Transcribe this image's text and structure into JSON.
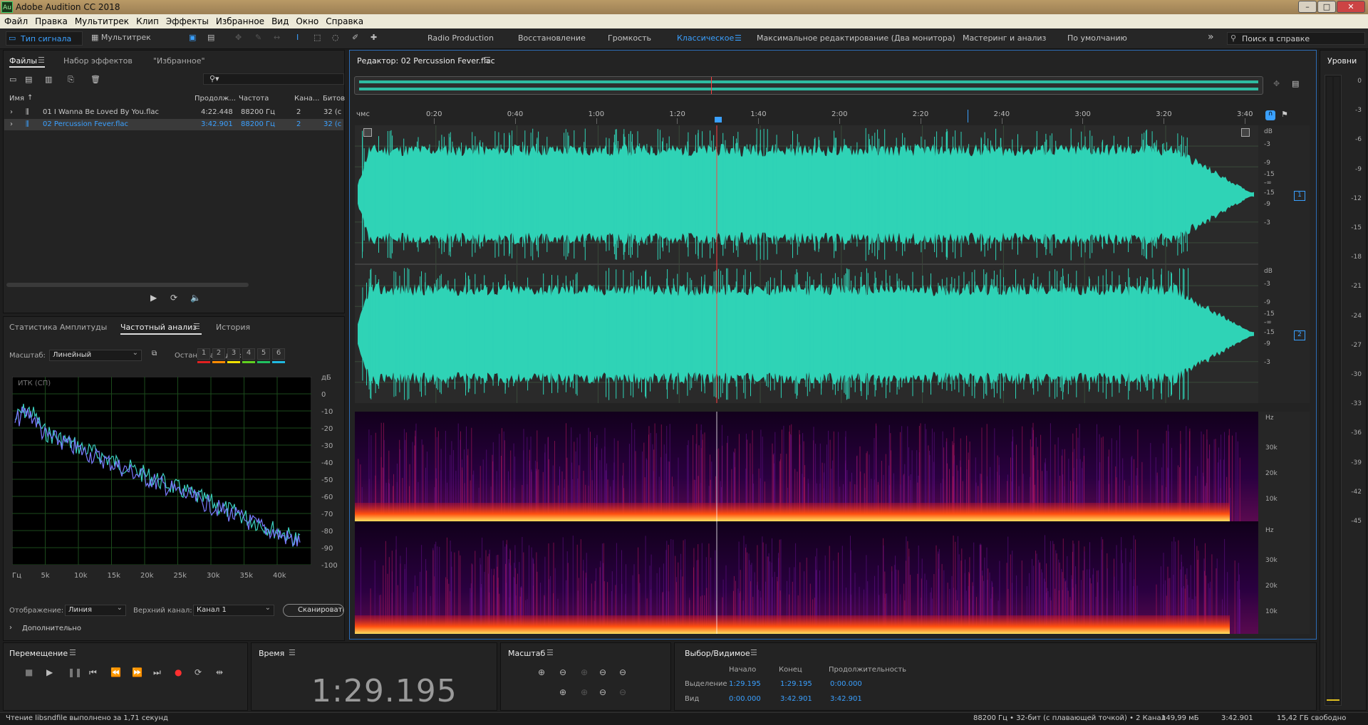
{
  "window": {
    "title": "Adobe Audition CC 2018",
    "app_icon": "Au",
    "controls": [
      "–",
      "□",
      "✕"
    ]
  },
  "menu": [
    "Файл",
    "Правка",
    "Мультитрек",
    "Клип",
    "Эффекты",
    "Избранное",
    "Вид",
    "Окно",
    "Справка"
  ],
  "toolbar": {
    "waveform_view": "Тип сигнала",
    "multitrack_view": "Мультитрек",
    "workspaces": [
      "Radio Production",
      "Восстановление",
      "Громкость",
      "Классическое",
      "Максимальное редактирование (Два монитора)",
      "Мастеринг и анализ",
      "По умолчанию"
    ],
    "active_workspace": "Классическое",
    "overflow": "»",
    "search_placeholder": "Поиск в справке"
  },
  "files_panel": {
    "tabs": [
      "Файлы",
      "Набор эффектов",
      "\"Избранное\""
    ],
    "columns": [
      "Имя",
      "Продолж...",
      "Частота",
      "Кана...",
      "Битов"
    ],
    "rows": [
      {
        "name": "01 I Wanna Be Loved By You.flac",
        "duration": "4:22.448",
        "rate": "88200 Гц",
        "channels": "2",
        "bits": "32 (с"
      },
      {
        "name": "02 Percussion Fever.flac",
        "duration": "3:42.901",
        "rate": "88200 Гц",
        "channels": "2",
        "bits": "32 (с"
      }
    ],
    "filter_icon": "⚲▾"
  },
  "analysis_panel": {
    "tabs": [
      "Статистика Амплитуды",
      "Частотный анализ",
      "История"
    ],
    "scale_label": "Масштаб:",
    "scale_value": "Линейный",
    "freeze_label": "Остановка кадра:",
    "freeze_slots": [
      "1",
      "2",
      "3",
      "4",
      "5",
      "6"
    ],
    "freeze_colors": [
      "#e02020",
      "#ff8a00",
      "#f0e000",
      "#60d020",
      "#20c060",
      "#20b8e0"
    ],
    "plot_label": "ИТК (СП)",
    "db_ticks": [
      "дБ",
      "0",
      "-10",
      "-20",
      "-30",
      "-40",
      "-50",
      "-60",
      "-70",
      "-80",
      "-90",
      "-100"
    ],
    "hz_ticks": [
      "Гц",
      "5k",
      "10k",
      "15k",
      "20k",
      "25k",
      "30k",
      "35k",
      "40k"
    ],
    "display_label": "Отображение:",
    "display_value": "Линия",
    "channel_label": "Верхний канал:",
    "channel_value": "Канал 1",
    "scan_button": "Сканировать",
    "advanced": "Дополнительно"
  },
  "editor": {
    "title": "Редактор: 02 Percussion Fever.flac",
    "time_unit": "чмс",
    "timeline_ticks": [
      "0:20",
      "0:40",
      "1:00",
      "1:20",
      "1:40",
      "2:00",
      "2:20",
      "2:40",
      "3:00",
      "3:20",
      "3:40"
    ],
    "db_ticks_ch": [
      "dB",
      "-3",
      "-9",
      "-15",
      "-∞",
      "-15",
      "-9",
      "-3"
    ],
    "channel_badges": [
      "1",
      "2"
    ],
    "hz_ticks": [
      "Hz",
      "30k",
      "20k",
      "10k"
    ],
    "wave_color": "#2fd3b6",
    "playhead_color": "#ff4040"
  },
  "levels": {
    "title": "Уровни",
    "ticks": [
      "0",
      "-3",
      "-6",
      "-9",
      "-12",
      "-15",
      "-18",
      "-21",
      "-24",
      "-27",
      "-30",
      "-33",
      "-36",
      "-39",
      "-42",
      "-45"
    ]
  },
  "transport": {
    "title": "Перемещение",
    "buttons": [
      "stop",
      "play",
      "pause",
      "to-start",
      "rewind",
      "fast-forward",
      "to-end",
      "record",
      "loop",
      "skip"
    ]
  },
  "time_panel": {
    "title": "Время",
    "value": "1:29.195"
  },
  "zoom_panel": {
    "title": "Масштаб"
  },
  "selection_panel": {
    "title": "Выбор/Видимое",
    "headers": [
      "Начало",
      "Конец",
      "Продолжительность"
    ],
    "rows": [
      {
        "label": "Выделение",
        "start": "1:29.195",
        "end": "1:29.195",
        "duration": "0:00.000"
      },
      {
        "label": "Вид",
        "start": "0:00.000",
        "end": "3:42.901",
        "duration": "3:42.901"
      }
    ]
  },
  "status": {
    "message": "Чтение libsndfile выполнено за 1,71 секунд",
    "format": "88200 Гц • 32-бит (с плавающей точкой) • 2 Канал",
    "size": "149,99 мБ",
    "duration": "3:42.901",
    "free": "15,42 ГБ свободно"
  }
}
